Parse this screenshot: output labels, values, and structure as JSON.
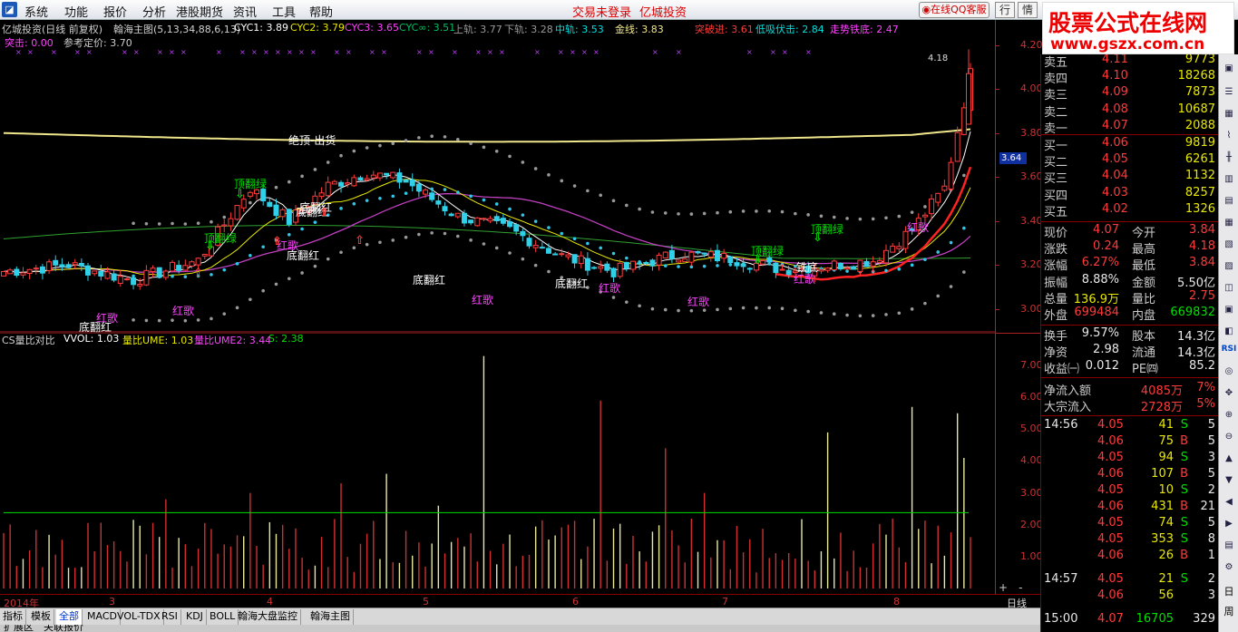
{
  "menu": {
    "items": [
      "系统",
      "功能",
      "报价",
      "分析",
      "港股期货",
      "资讯",
      "工具",
      "帮助"
    ],
    "alert1": "交易未登录",
    "alert2": "亿城投资",
    "qq_button": "在线QQ客服",
    "btn_hang": "行",
    "btn_qing": "情"
  },
  "watermark": {
    "title": "股票公式在线网",
    "url": "www.gszx.com.cn"
  },
  "main_chart": {
    "header_line1": [
      {
        "text": "亿城投资(日线 前复权)",
        "color": "#d0d0d0"
      },
      {
        "text": "翰海主图(5,13,34,88,6,13)",
        "color": "#d0d0d0"
      },
      {
        "text": "CYC1: 3.89",
        "color": "#ffffff"
      },
      {
        "text": "CYC2: 3.79",
        "color": "#e8e800"
      },
      {
        "text": "CYC3: 3.65",
        "color": "#ff44ff"
      },
      {
        "text": "CYC∞: 3.51",
        "color": "#00c060"
      },
      {
        "text": "上轨: 3.77",
        "color": "#999999"
      },
      {
        "text": "下轨: 3.28",
        "color": "#999999"
      },
      {
        "text": "中轨: 3.53",
        "color": "#00e0e0"
      },
      {
        "text": "金线: 3.83",
        "color": "#f0e68c"
      },
      {
        "text": "突破进: 3.61",
        "color": "#ff3b3b"
      },
      {
        "text": "低吸伏击: 2.84",
        "color": "#00e0e0"
      },
      {
        "text": "走势铁底: 2.47",
        "color": "#ff44ff"
      }
    ],
    "header_line2": [
      {
        "text": "突击: 0.00",
        "color": "#ff44ff"
      },
      {
        "text": "参考定价: 3.70",
        "color": "#cccccc"
      }
    ],
    "y_ticks": [
      "4.20",
      "4.00",
      "3.80",
      "3.60",
      "3.40",
      "3.20",
      "3.00"
    ],
    "y_min": 2.92,
    "y_max": 4.24,
    "current_price_tag": "3.64",
    "high_marker": "4.18",
    "annotations": [
      {
        "text": "顶翻绿",
        "color": "#00e000"
      },
      {
        "text": "顶翻绿",
        "color": "#00e000"
      },
      {
        "text": "绝顶-出货",
        "color": "#ffffff"
      },
      {
        "text": "底翻红",
        "color": "#ffffff"
      },
      {
        "text": "红歌",
        "color": "#ff44ff"
      },
      {
        "text": "红歌",
        "color": "#ff44ff"
      },
      {
        "text": "底翻红",
        "color": "#ffffff"
      },
      {
        "text": "红歌",
        "color": "#ff44ff"
      },
      {
        "text": "底翻红",
        "color": "#ffffff"
      },
      {
        "text": "红歌",
        "color": "#ff44ff"
      },
      {
        "text": "底翻红",
        "color": "#ffffff"
      },
      {
        "text": "红歌",
        "color": "#ff44ff"
      },
      {
        "text": "顶翻绿",
        "color": "#00e000"
      },
      {
        "text": "红歌",
        "color": "#ff44ff"
      },
      {
        "text": "顶翻绿",
        "color": "#00e000"
      },
      {
        "text": "铁底",
        "color": "#ffffff"
      },
      {
        "text": "红歌",
        "color": "#ff44ff"
      },
      {
        "text": "底翻红",
        "color": "#ffffff"
      },
      {
        "text": "红歌",
        "color": "#ff44ff"
      },
      {
        "text": "底翻红",
        "color": "#ffffff"
      }
    ]
  },
  "vol_chart": {
    "header": [
      {
        "text": "CS量比对比",
        "color": "#d0d0d0"
      },
      {
        "text": "VVOL: 1.03",
        "color": "#ffffff"
      },
      {
        "text": "量比UME: 1.03",
        "color": "#e8e800"
      },
      {
        "text": "量比UME2: 3.44",
        "color": "#ff44ff"
      },
      {
        "text": "S: 2.38",
        "color": "#00e000"
      }
    ],
    "y_ticks": [
      "7.00",
      "6.00",
      "5.00",
      "4.00",
      "3.00",
      "2.00",
      "1.00"
    ],
    "y_max": 7.8
  },
  "date_axis": {
    "labels": [
      "2014年",
      "3",
      "4",
      "5",
      "6",
      "7",
      "8"
    ],
    "period": "日线"
  },
  "tabs": [
    "指标",
    "模板",
    "全部",
    "MACD",
    "VOL-TDX",
    "RSI",
    "KDJ",
    "BOLL",
    "翰海大盘监控",
    "翰海主图"
  ],
  "bottom_tabs": [
    "扩展区",
    "关联报价"
  ],
  "order_book": {
    "asks": [
      {
        "label": "卖五",
        "price": "4.11",
        "vol": "9773"
      },
      {
        "label": "卖四",
        "price": "4.10",
        "vol": "18268"
      },
      {
        "label": "卖三",
        "price": "4.09",
        "vol": "7873"
      },
      {
        "label": "卖二",
        "price": "4.08",
        "vol": "10687"
      },
      {
        "label": "卖一",
        "price": "4.07",
        "vol": "2088"
      }
    ],
    "bids": [
      {
        "label": "买一",
        "price": "4.06",
        "vol": "9819"
      },
      {
        "label": "买二",
        "price": "4.05",
        "vol": "6261"
      },
      {
        "label": "买三",
        "price": "4.04",
        "vol": "1132"
      },
      {
        "label": "买四",
        "price": "4.03",
        "vol": "8257"
      },
      {
        "label": "买五",
        "price": "4.02",
        "vol": "1326"
      }
    ]
  },
  "quote": {
    "xianjia_label": "现价",
    "xianjia": "4.07",
    "jinkai_label": "今开",
    "jinkai": "3.84",
    "zhangdie_label": "涨跌",
    "zhangdie": "0.24",
    "zuigao_label": "最高",
    "zuigao": "4.18",
    "zhangfu_label": "涨幅",
    "zhangfu": "6.27%",
    "zuidi_label": "最低",
    "zuidi": "3.84",
    "zhenfu_label": "振幅",
    "zhenfu": "8.88%",
    "jine_label": "金额",
    "jine": "5.50亿",
    "zongliang_label": "总量",
    "zongliang": "136.9万",
    "liangbi_label": "量比",
    "liangbi": "2.75",
    "waipan_label": "外盘",
    "waipan": "699484",
    "neipan_label": "内盘",
    "neipan": "669832",
    "huanshou_label": "换手",
    "huanshou": "9.57%",
    "guben_label": "股本",
    "guben": "14.3亿",
    "jingzi_label": "净资",
    "jingzi": "2.98",
    "liutong_label": "流通",
    "liutong": "14.3亿",
    "shouyi_label": "收益㈠",
    "shouyi": "0.012",
    "pe_label": "PE㈣",
    "pe": "85.2",
    "jingliuru_label": "净流入额",
    "jingliuru": "4085万",
    "jingliuru_pct": "7%",
    "dazong_label": "大宗流入",
    "dazong": "2728万",
    "dazong_pct": "5%"
  },
  "ticks": [
    {
      "time": "14:56",
      "price": "4.05",
      "vol": "41",
      "side": "S",
      "n": "5"
    },
    {
      "time": "",
      "price": "4.06",
      "vol": "75",
      "side": "B",
      "n": "5"
    },
    {
      "time": "",
      "price": "4.05",
      "vol": "94",
      "side": "S",
      "n": "3"
    },
    {
      "time": "",
      "price": "4.06",
      "vol": "107",
      "side": "B",
      "n": "5"
    },
    {
      "time": "",
      "price": "4.05",
      "vol": "10",
      "side": "S",
      "n": "2"
    },
    {
      "time": "",
      "price": "4.06",
      "vol": "431",
      "side": "B",
      "n": "21"
    },
    {
      "time": "",
      "price": "4.05",
      "vol": "74",
      "side": "S",
      "n": "5"
    },
    {
      "time": "",
      "price": "4.05",
      "vol": "353",
      "side": "S",
      "n": "8"
    },
    {
      "time": "",
      "price": "4.06",
      "vol": "26",
      "side": "B",
      "n": "1"
    },
    {
      "time": "14:57",
      "price": "4.05",
      "vol": "21",
      "side": "S",
      "n": "2"
    },
    {
      "time": "",
      "price": "4.06",
      "vol": "56",
      "side": "",
      "n": "3"
    },
    {
      "time": "15:00",
      "price": "4.07",
      "vol": "16705",
      "side": "",
      "n": "329"
    }
  ],
  "right_toolbar": {
    "text1": "RSI",
    "text2": "日",
    "text3": "周"
  },
  "colors": {
    "up": "#ff3b3b",
    "down": "#00e0e0",
    "background": "#000000",
    "axis": "#aa2222"
  }
}
